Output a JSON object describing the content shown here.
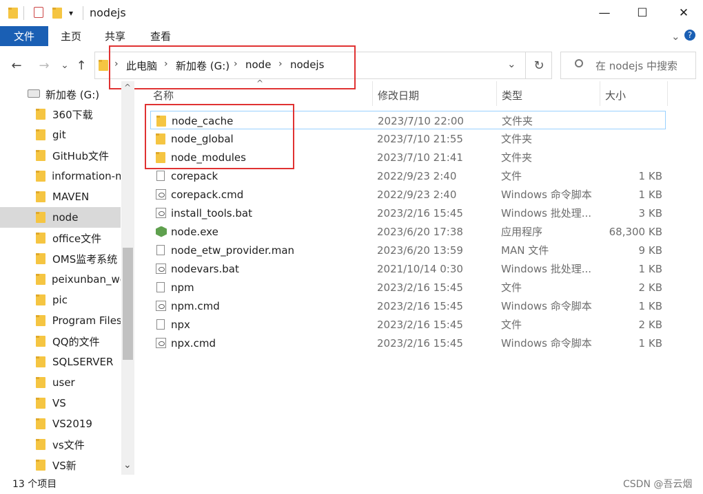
{
  "window": {
    "title": "nodejs",
    "minimize": "—",
    "maximize": "☐",
    "close": "✕"
  },
  "ribbon": {
    "tabs": [
      "文件",
      "主页",
      "共享",
      "查看"
    ],
    "expand": "⌄",
    "help": "?"
  },
  "nav": {
    "back": "←",
    "forward": "→",
    "recent": "⌄",
    "up": "↑"
  },
  "address": {
    "crumbs": [
      "此电脑",
      "新加卷 (G:)",
      "node",
      "nodejs"
    ],
    "sep": "›",
    "dropdown": "⌄",
    "refresh": "↻"
  },
  "search": {
    "placeholder": "在 nodejs 中搜索"
  },
  "sidebar": {
    "drive": "新加卷 (G:)",
    "items": [
      "360下载",
      "git",
      "GitHub文件",
      "information-m",
      "MAVEN",
      "node",
      "office文件",
      "OMS监考系统",
      "peixunban_we",
      "pic",
      "Program Files",
      "QQ的文件",
      "SQLSERVER",
      "user",
      "VS",
      "VS2019",
      "vs文件",
      "VS新"
    ],
    "selected": "node",
    "scroll_up": "^",
    "scroll_down": "⌄"
  },
  "list": {
    "columns": [
      "名称",
      "修改日期",
      "类型",
      "大小"
    ],
    "sort_arrow": "^",
    "rows": [
      {
        "name": "node_cache",
        "date": "2023/7/10 22:00",
        "type": "文件夹",
        "size": "",
        "icon": "folder"
      },
      {
        "name": "node_global",
        "date": "2023/7/10 21:55",
        "type": "文件夹",
        "size": "",
        "icon": "folder"
      },
      {
        "name": "node_modules",
        "date": "2023/7/10 21:41",
        "type": "文件夹",
        "size": "",
        "icon": "folder"
      },
      {
        "name": "corepack",
        "date": "2022/9/23 2:40",
        "type": "文件",
        "size": "1 KB",
        "icon": "file"
      },
      {
        "name": "corepack.cmd",
        "date": "2022/9/23 2:40",
        "type": "Windows 命令脚本",
        "size": "1 KB",
        "icon": "bat"
      },
      {
        "name": "install_tools.bat",
        "date": "2023/2/16 15:45",
        "type": "Windows 批处理...",
        "size": "3 KB",
        "icon": "bat"
      },
      {
        "name": "node.exe",
        "date": "2023/6/20 17:38",
        "type": "应用程序",
        "size": "68,300 KB",
        "icon": "exe"
      },
      {
        "name": "node_etw_provider.man",
        "date": "2023/6/20 13:59",
        "type": "MAN 文件",
        "size": "9 KB",
        "icon": "file"
      },
      {
        "name": "nodevars.bat",
        "date": "2021/10/14 0:30",
        "type": "Windows 批处理...",
        "size": "1 KB",
        "icon": "bat"
      },
      {
        "name": "npm",
        "date": "2023/2/16 15:45",
        "type": "文件",
        "size": "2 KB",
        "icon": "file"
      },
      {
        "name": "npm.cmd",
        "date": "2023/2/16 15:45",
        "type": "Windows 命令脚本",
        "size": "1 KB",
        "icon": "bat"
      },
      {
        "name": "npx",
        "date": "2023/2/16 15:45",
        "type": "文件",
        "size": "2 KB",
        "icon": "file"
      },
      {
        "name": "npx.cmd",
        "date": "2023/2/16 15:45",
        "type": "Windows 命令脚本",
        "size": "1 KB",
        "icon": "bat"
      }
    ]
  },
  "status": {
    "count": "13 个项目"
  },
  "watermark": "CSDN @吾云烟",
  "colors": {
    "accent": "#1a5fb4",
    "highlight": "#e03131",
    "hover_border": "#99d1ff"
  }
}
